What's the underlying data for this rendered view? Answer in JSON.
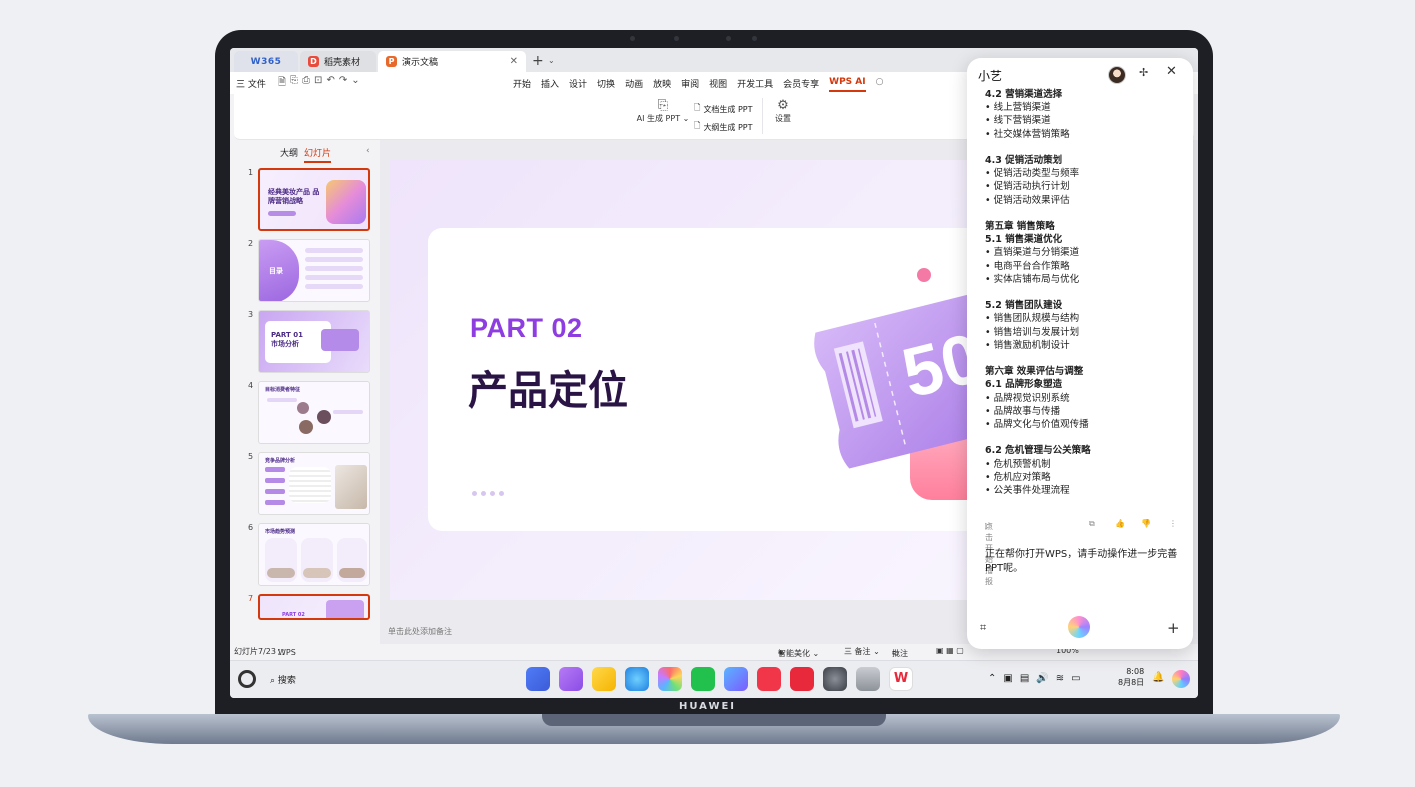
{
  "device": {
    "brand": "HUAWEI"
  },
  "tabs": [
    {
      "label": "W365"
    },
    {
      "label": "稻壳素材"
    },
    {
      "label": "演示文稿",
      "active": true
    }
  ],
  "menubar": {
    "file": "三 文件",
    "items": [
      "开始",
      "插入",
      "设计",
      "切换",
      "动画",
      "放映",
      "审阅",
      "视图",
      "开发工具",
      "会员专享",
      "WPS AI"
    ]
  },
  "ribbon": {
    "ai_generate": "AI 生成 PPT ⌄",
    "doc_generate": "文档生成 PPT",
    "outline_generate": "大纲生成 PPT",
    "settings": "设置"
  },
  "slide_panel": {
    "outline_tab": "大纲",
    "slides_tab": "幻灯片",
    "thumbnails": [
      {
        "num": "1",
        "title": "经典美妆产品 品牌营销战略"
      },
      {
        "num": "2",
        "title": "目录"
      },
      {
        "num": "3",
        "title": "PART 01 市场分析"
      },
      {
        "num": "4",
        "title": "目标消费者特征"
      },
      {
        "num": "5",
        "title": "竞争品牌分析"
      },
      {
        "num": "6",
        "title": "市场趋势预测"
      },
      {
        "num": "7",
        "title": "PART 02"
      }
    ]
  },
  "slide": {
    "part": "PART 02",
    "title": "产品定位",
    "ticket_text": "50"
  },
  "notes_placeholder": "单击此处添加备注",
  "status": {
    "slide_count": "幻灯片7/23",
    "theme": "WPS",
    "beautify": "智能美化 ⌄",
    "notes": "三 备注 ⌄",
    "comments": "批注",
    "zoom": "100%"
  },
  "taskbar": {
    "search": "搜索",
    "time": "8:08",
    "date": "8月8日"
  },
  "assistant": {
    "title": "小艺",
    "content": [
      {
        "t": "4.2 营销渠道选择",
        "h": true
      },
      {
        "t": "• 线上营销渠道"
      },
      {
        "t": "• 线下营销渠道"
      },
      {
        "t": "• 社交媒体营销策略"
      },
      {
        "t": ""
      },
      {
        "t": "4.3 促销活动策划",
        "h": true
      },
      {
        "t": "• 促销活动类型与频率"
      },
      {
        "t": "• 促销活动执行计划"
      },
      {
        "t": "• 促销活动效果评估"
      },
      {
        "t": ""
      },
      {
        "t": "第五章 销售策略",
        "h": true
      },
      {
        "t": "5.1 销售渠道优化",
        "h": true
      },
      {
        "t": "• 直销渠道与分销渠道"
      },
      {
        "t": "• 电商平台合作策略"
      },
      {
        "t": "• 实体店铺布局与优化"
      },
      {
        "t": ""
      },
      {
        "t": "5.2 销售团队建设",
        "h": true
      },
      {
        "t": "• 销售团队规模与结构"
      },
      {
        "t": "• 销售培训与发展计划"
      },
      {
        "t": "• 销售激励机制设计"
      },
      {
        "t": ""
      },
      {
        "t": "第六章 效果评估与调整",
        "h": true
      },
      {
        "t": "6.1 品牌形象塑造",
        "h": true
      },
      {
        "t": "• 品牌视觉识别系统"
      },
      {
        "t": "• 品牌故事与传播"
      },
      {
        "t": "• 品牌文化与价值观传播"
      },
      {
        "t": ""
      },
      {
        "t": "6.2 危机管理与公关策略",
        "h": true
      },
      {
        "t": "• 危机预警机制"
      },
      {
        "t": "• 危机应对策略"
      },
      {
        "t": "• 公关事件处理流程"
      }
    ],
    "play_label": "点击开始播报",
    "message": "正在帮你打开WPS，请手动操作进一步完善PPT呢。"
  }
}
